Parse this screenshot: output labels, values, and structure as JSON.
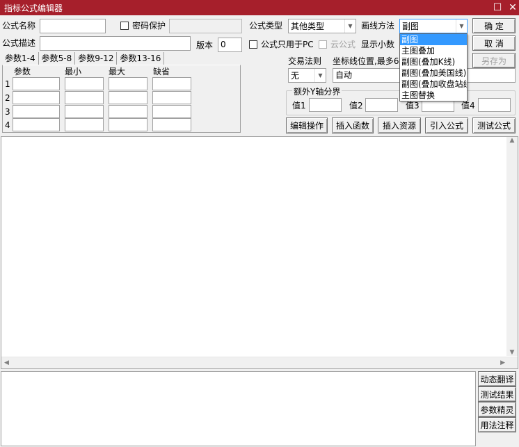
{
  "window": {
    "title": "指标公式编辑器",
    "restore_glyph": "☐",
    "close_glyph": "✕"
  },
  "form": {
    "formula_name_label": "公式名称",
    "formula_name_value": "",
    "password_label": "密码保护",
    "password_value": "",
    "formula_type_label": "公式类型",
    "formula_type_value": "其他类型",
    "draw_method_label": "画线方法",
    "draw_method_value": "副图",
    "formula_desc_label": "公式描述",
    "formula_desc_value": "",
    "version_label": "版本",
    "version_value": "0",
    "pc_only_label": "公式只用于PC",
    "cloud_label": "云公式",
    "show_decimals_label": "显示小数"
  },
  "buttons": {
    "confirm": "确  定",
    "cancel": "取  消",
    "save_as": "另存为",
    "edit_ops": "编辑操作",
    "insert_func": "插入函数",
    "insert_res": "插入资源",
    "import_formula": "引入公式",
    "test_formula": "测试公式",
    "dynamic_translate": "动态翻译",
    "test_result": "测试结果",
    "param_wizard": "参数精灵",
    "usage_notes": "用法注释"
  },
  "param_tabs": [
    "参数1-4",
    "参数5-8",
    "参数9-12",
    "参数13-16"
  ],
  "param_table": {
    "headers": [
      "参数",
      "最小",
      "最大",
      "缺省"
    ],
    "rows": [
      "1",
      "2",
      "3",
      "4"
    ]
  },
  "trade_rule": {
    "label": "交易法则",
    "value": "无"
  },
  "axis_pos": {
    "label": "坐标线位置,最多6",
    "value": "自动"
  },
  "y_axis": {
    "legend": "额外Y轴分界",
    "labels": [
      "值1",
      "值2",
      "值3",
      "值4"
    ]
  },
  "draw_method_options": [
    "副图",
    "主图叠加",
    "副图(叠加K线)",
    "副图(叠加美国线)",
    "副图(叠加收盘站线)",
    "主图替换"
  ],
  "colors": {
    "title_bar": "#a61f2b",
    "selection": "#3399ff"
  }
}
